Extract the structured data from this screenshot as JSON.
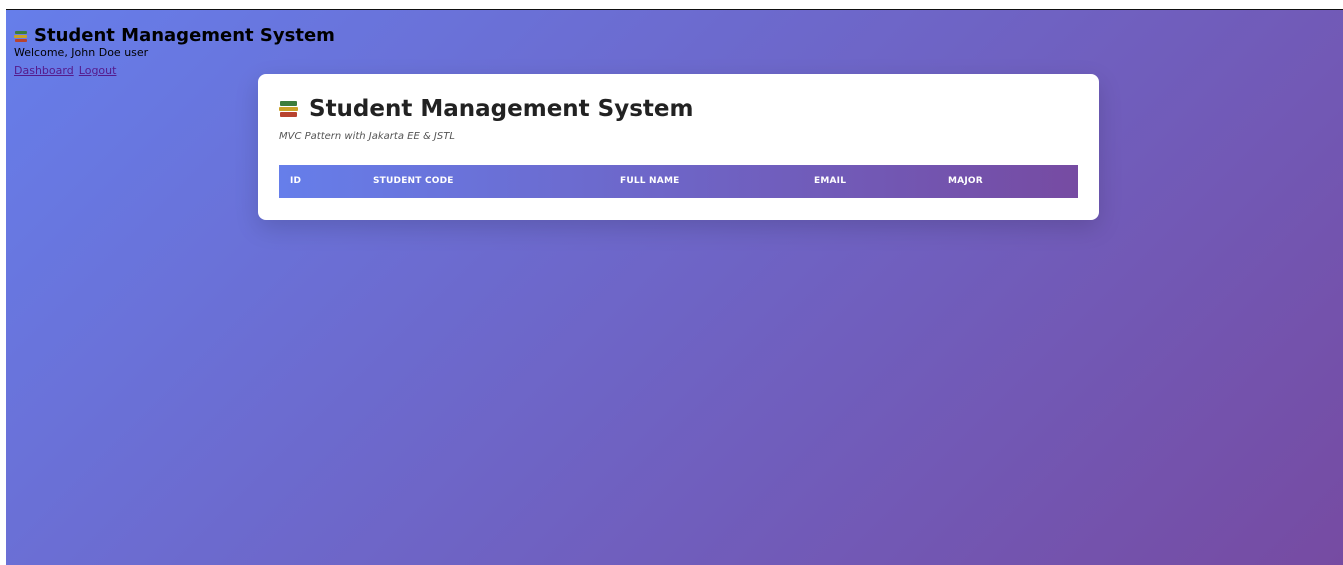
{
  "header": {
    "title": "Student Management System",
    "welcome_text": "Welcome, John Doe user",
    "links": {
      "dashboard": "Dashboard",
      "logout": "Logout"
    }
  },
  "card": {
    "title": "Student Management System",
    "subtitle": "MVC Pattern with Jakarta EE & JSTL",
    "table": {
      "columns": [
        "ID",
        "STUDENT CODE",
        "FULL NAME",
        "EMAIL",
        "MAJOR"
      ],
      "rows": []
    }
  },
  "colors": {
    "gradient_start": "#667eea",
    "gradient_end": "#764ba2"
  },
  "icons": {
    "title_icon": "books-icon"
  }
}
